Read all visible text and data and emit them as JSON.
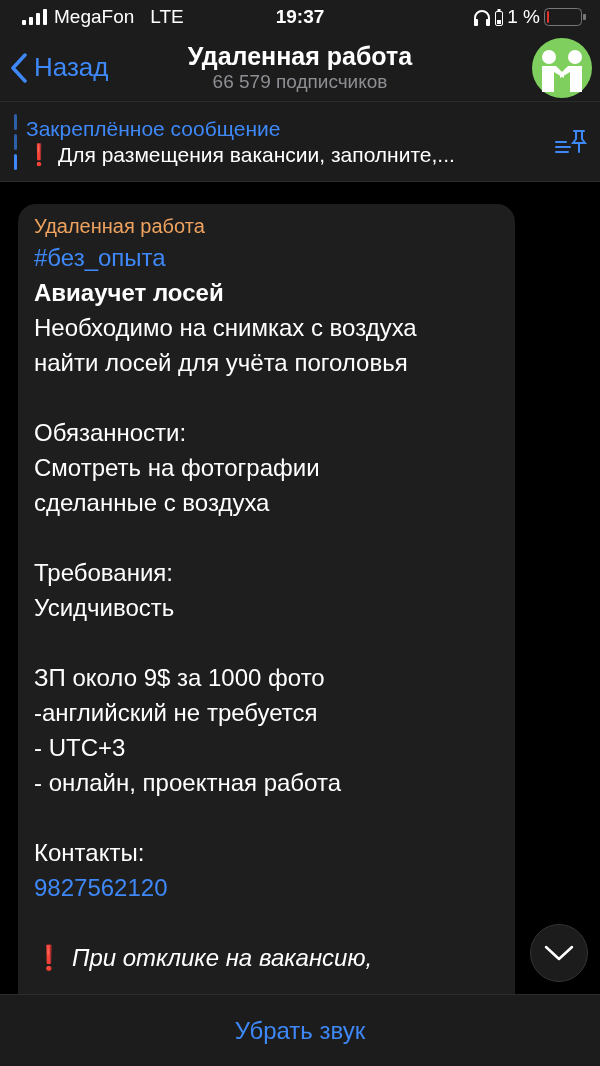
{
  "status_bar": {
    "carrier": "MegaFon",
    "network": "LTE",
    "time": "19:37",
    "battery_text": "1 %"
  },
  "header": {
    "back_label": "Назад",
    "title": "Удаленная работа",
    "subtitle": "66 579 подписчиков"
  },
  "pinned": {
    "title": "Закреплённое сообщение",
    "mark": "❗",
    "text": "Для размещения вакансии, заполните,..."
  },
  "message": {
    "channel": "Удаленная работа",
    "paragraphs": [
      [
        {
          "kind": "link",
          "text": "#без_опыта"
        },
        {
          "kind": "title",
          "text": "Авиаучет лосей"
        },
        {
          "kind": "text",
          "text": "Необходимо на снимках с воздуха\nнайти лосей для учёта поголовья"
        }
      ],
      [
        {
          "kind": "text",
          "text": "Обязанности:\nСмотреть на фотографии\nсделанные с воздуха"
        }
      ],
      [
        {
          "kind": "text",
          "text": "Требования:\nУсидчивость"
        }
      ],
      [
        {
          "kind": "text",
          "text": "ЗП около 9$ за 1000 фото\n-английский не требуется\n- UTC+3\n- онлайн, проектная работа"
        }
      ],
      [
        {
          "kind": "text",
          "text": "Контакты:"
        },
        {
          "kind": "link",
          "text": "9827562120"
        }
      ],
      [
        {
          "kind": "italic",
          "mark": "❗",
          "text": "При отклике на вакансию,"
        }
      ]
    ]
  },
  "bottom_bar": {
    "action": "Убрать звук"
  }
}
